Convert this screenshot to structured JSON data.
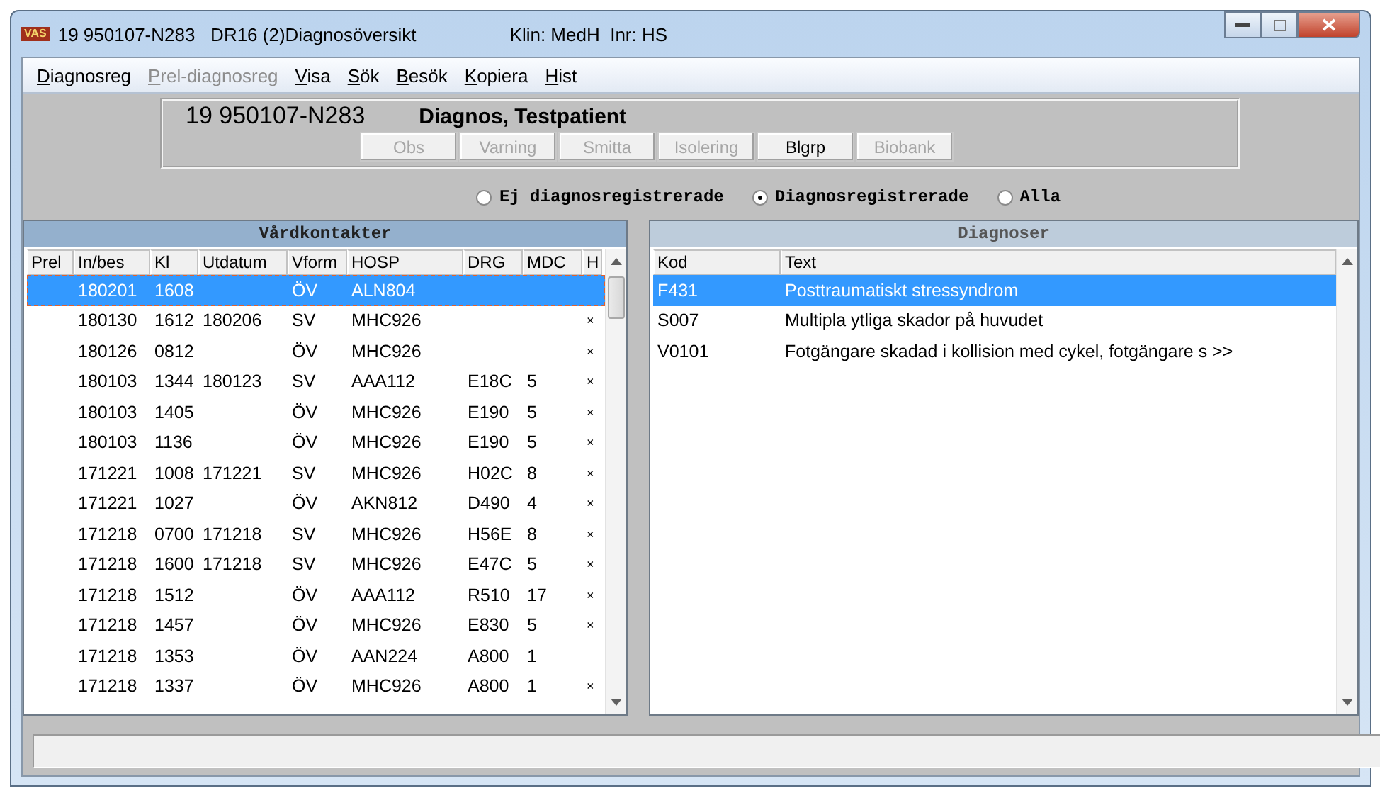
{
  "window": {
    "title": "19 950107-N283   DR16 (2)Diagnosöversikt",
    "context": "Klin: MedH  Inr: HS",
    "logo": "VAS"
  },
  "menu": [
    {
      "label": "Diagnosreg",
      "disabled": false
    },
    {
      "label": "Prel-diagnosreg",
      "disabled": true
    },
    {
      "label": "Visa",
      "disabled": false
    },
    {
      "label": "Sök",
      "disabled": false
    },
    {
      "label": "Besök",
      "disabled": false
    },
    {
      "label": "Kopiera",
      "disabled": false
    },
    {
      "label": "Hist",
      "disabled": false
    }
  ],
  "patient": {
    "id": "19 950107-N283",
    "name": "Diagnos, Testpatient"
  },
  "flag_buttons": [
    {
      "label": "Obs",
      "disabled": true
    },
    {
      "label": "Varning",
      "disabled": true
    },
    {
      "label": "Smitta",
      "disabled": true
    },
    {
      "label": "Isolering",
      "disabled": true
    },
    {
      "label": "Blgrp",
      "disabled": false
    },
    {
      "label": "Biobank",
      "disabled": true
    }
  ],
  "filter": [
    {
      "label": "Ej diagnosregistrerade",
      "selected": false
    },
    {
      "label": "Diagnosregistrerade",
      "selected": true
    },
    {
      "label": "Alla",
      "selected": false
    }
  ],
  "contacts": {
    "title": "Vårdkontakter",
    "columns": [
      "Prel",
      "In/bes",
      "Kl",
      "Utdatum",
      "Vform",
      "HOSP",
      "DRG",
      "MDC",
      "H"
    ],
    "rows": [
      {
        "selected": true,
        "cells": [
          "",
          "180201",
          "1608",
          "",
          "ÖV",
          "ALN804",
          "",
          "",
          ""
        ]
      },
      {
        "selected": false,
        "cells": [
          "",
          "180130",
          "1612",
          "180206",
          "SV",
          "MHC926",
          "",
          "",
          "×"
        ]
      },
      {
        "selected": false,
        "cells": [
          "",
          "180126",
          "0812",
          "",
          "ÖV",
          "MHC926",
          "",
          "",
          "×"
        ]
      },
      {
        "selected": false,
        "cells": [
          "",
          "180103",
          "1344",
          "180123",
          "SV",
          "AAA112",
          "E18C",
          "5",
          "×"
        ]
      },
      {
        "selected": false,
        "cells": [
          "",
          "180103",
          "1405",
          "",
          "ÖV",
          "MHC926",
          "E190",
          "5",
          "×"
        ]
      },
      {
        "selected": false,
        "cells": [
          "",
          "180103",
          "1136",
          "",
          "ÖV",
          "MHC926",
          "E190",
          "5",
          "×"
        ]
      },
      {
        "selected": false,
        "cells": [
          "",
          "171221",
          "1008",
          "171221",
          "SV",
          "MHC926",
          "H02C",
          "8",
          "×"
        ]
      },
      {
        "selected": false,
        "cells": [
          "",
          "171221",
          "1027",
          "",
          "ÖV",
          "AKN812",
          "D490",
          "4",
          "×"
        ]
      },
      {
        "selected": false,
        "cells": [
          "",
          "171218",
          "0700",
          "171218",
          "SV",
          "MHC926",
          "H56E",
          "8",
          "×"
        ]
      },
      {
        "selected": false,
        "cells": [
          "",
          "171218",
          "1600",
          "171218",
          "SV",
          "MHC926",
          "E47C",
          "5",
          "×"
        ]
      },
      {
        "selected": false,
        "cells": [
          "",
          "171218",
          "1512",
          "",
          "ÖV",
          "AAA112",
          "R510",
          "17",
          "×"
        ]
      },
      {
        "selected": false,
        "cells": [
          "",
          "171218",
          "1457",
          "",
          "ÖV",
          "MHC926",
          "E830",
          "5",
          "×"
        ]
      },
      {
        "selected": false,
        "cells": [
          "",
          "171218",
          "1353",
          "",
          "ÖV",
          "AAN224",
          "A800",
          "1",
          ""
        ]
      },
      {
        "selected": false,
        "cells": [
          "",
          "171218",
          "1337",
          "",
          "ÖV",
          "MHC926",
          "A800",
          "1",
          "×"
        ]
      }
    ]
  },
  "diagnoses": {
    "title": "Diagnoser",
    "columns": [
      "Kod",
      "Text"
    ],
    "rows": [
      {
        "selected": true,
        "code": "F431",
        "text": "Posttraumatiskt stressyndrom"
      },
      {
        "selected": false,
        "code": "S007",
        "text": "Multipla ytliga skador på huvudet"
      },
      {
        "selected": false,
        "code": "V0101",
        "text": "Fotgängare skadad i kollision med cykel, fotgängare s >>"
      }
    ]
  }
}
